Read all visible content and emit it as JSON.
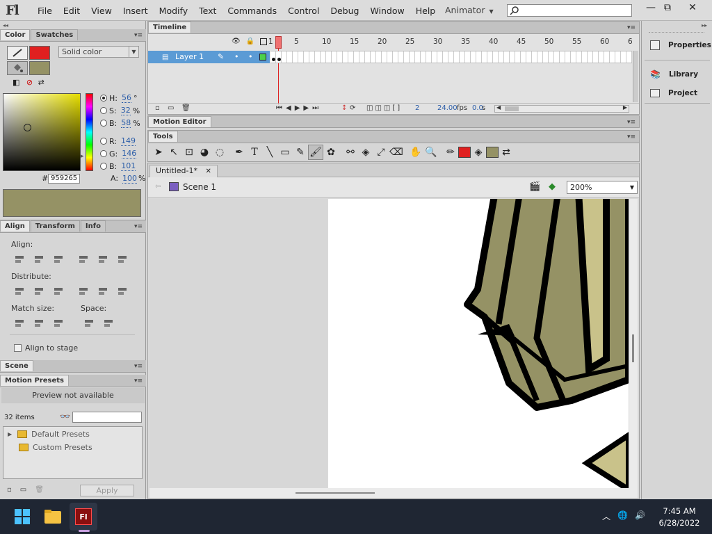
{
  "app": {
    "logo": "Fl"
  },
  "menu": [
    "File",
    "Edit",
    "View",
    "Insert",
    "Modify",
    "Text",
    "Commands",
    "Control",
    "Debug",
    "Window",
    "Help"
  ],
  "workspace": "Animator",
  "window_buttons": {
    "min": "—",
    "restore": "⧉",
    "close": "✕"
  },
  "color_panel": {
    "tabs": [
      "Color",
      "Swatches"
    ],
    "fill_type": "Solid color",
    "stroke_color": "#e02020",
    "fill_color": "#959265",
    "hsb": {
      "h": "56",
      "s": "32",
      "b": "58"
    },
    "rgb": {
      "r": "149",
      "g": "146",
      "b": "101"
    },
    "hex_label": "#",
    "hex": "959265",
    "alpha_label": "A:",
    "alpha": "100",
    "labels": {
      "h": "H:",
      "s": "S:",
      "b": "B:",
      "r": "R:",
      "g": "G:",
      "bb": "B:",
      "deg": "°",
      "pct": "%"
    }
  },
  "align_panel": {
    "tabs": [
      "Align",
      "Transform",
      "Info"
    ],
    "align_label": "Align:",
    "distribute_label": "Distribute:",
    "match_size_label": "Match size:",
    "space_label": "Space:",
    "align_to_stage": "Align to stage"
  },
  "scene_panel": {
    "title": "Scene"
  },
  "motion_presets": {
    "title": "Motion Presets",
    "preview": "Preview not available",
    "count": "32 items",
    "folders": [
      "Default Presets",
      "Custom Presets"
    ],
    "apply": "Apply"
  },
  "timeline": {
    "title": "Timeline",
    "layer_name": "Layer 1",
    "ruler": [
      "1",
      "5",
      "10",
      "15",
      "20",
      "25",
      "30",
      "35",
      "40",
      "45",
      "50",
      "55",
      "60",
      "6"
    ],
    "current_frame": "2",
    "fps": "24.00",
    "fps_unit": "fps",
    "time": "0.0",
    "time_unit": "s"
  },
  "motion_editor": {
    "title": "Motion Editor"
  },
  "tools": {
    "title": "Tools",
    "stroke_color": "#e02020",
    "fill_color": "#959265"
  },
  "document": {
    "tab": "Untitled-1*",
    "scene": "Scene 1",
    "zoom": "200%"
  },
  "right_panel": {
    "items": [
      "Properties",
      "Library",
      "Project"
    ]
  },
  "taskbar": {
    "time": "7:45 AM",
    "date": "6/28/2022"
  }
}
